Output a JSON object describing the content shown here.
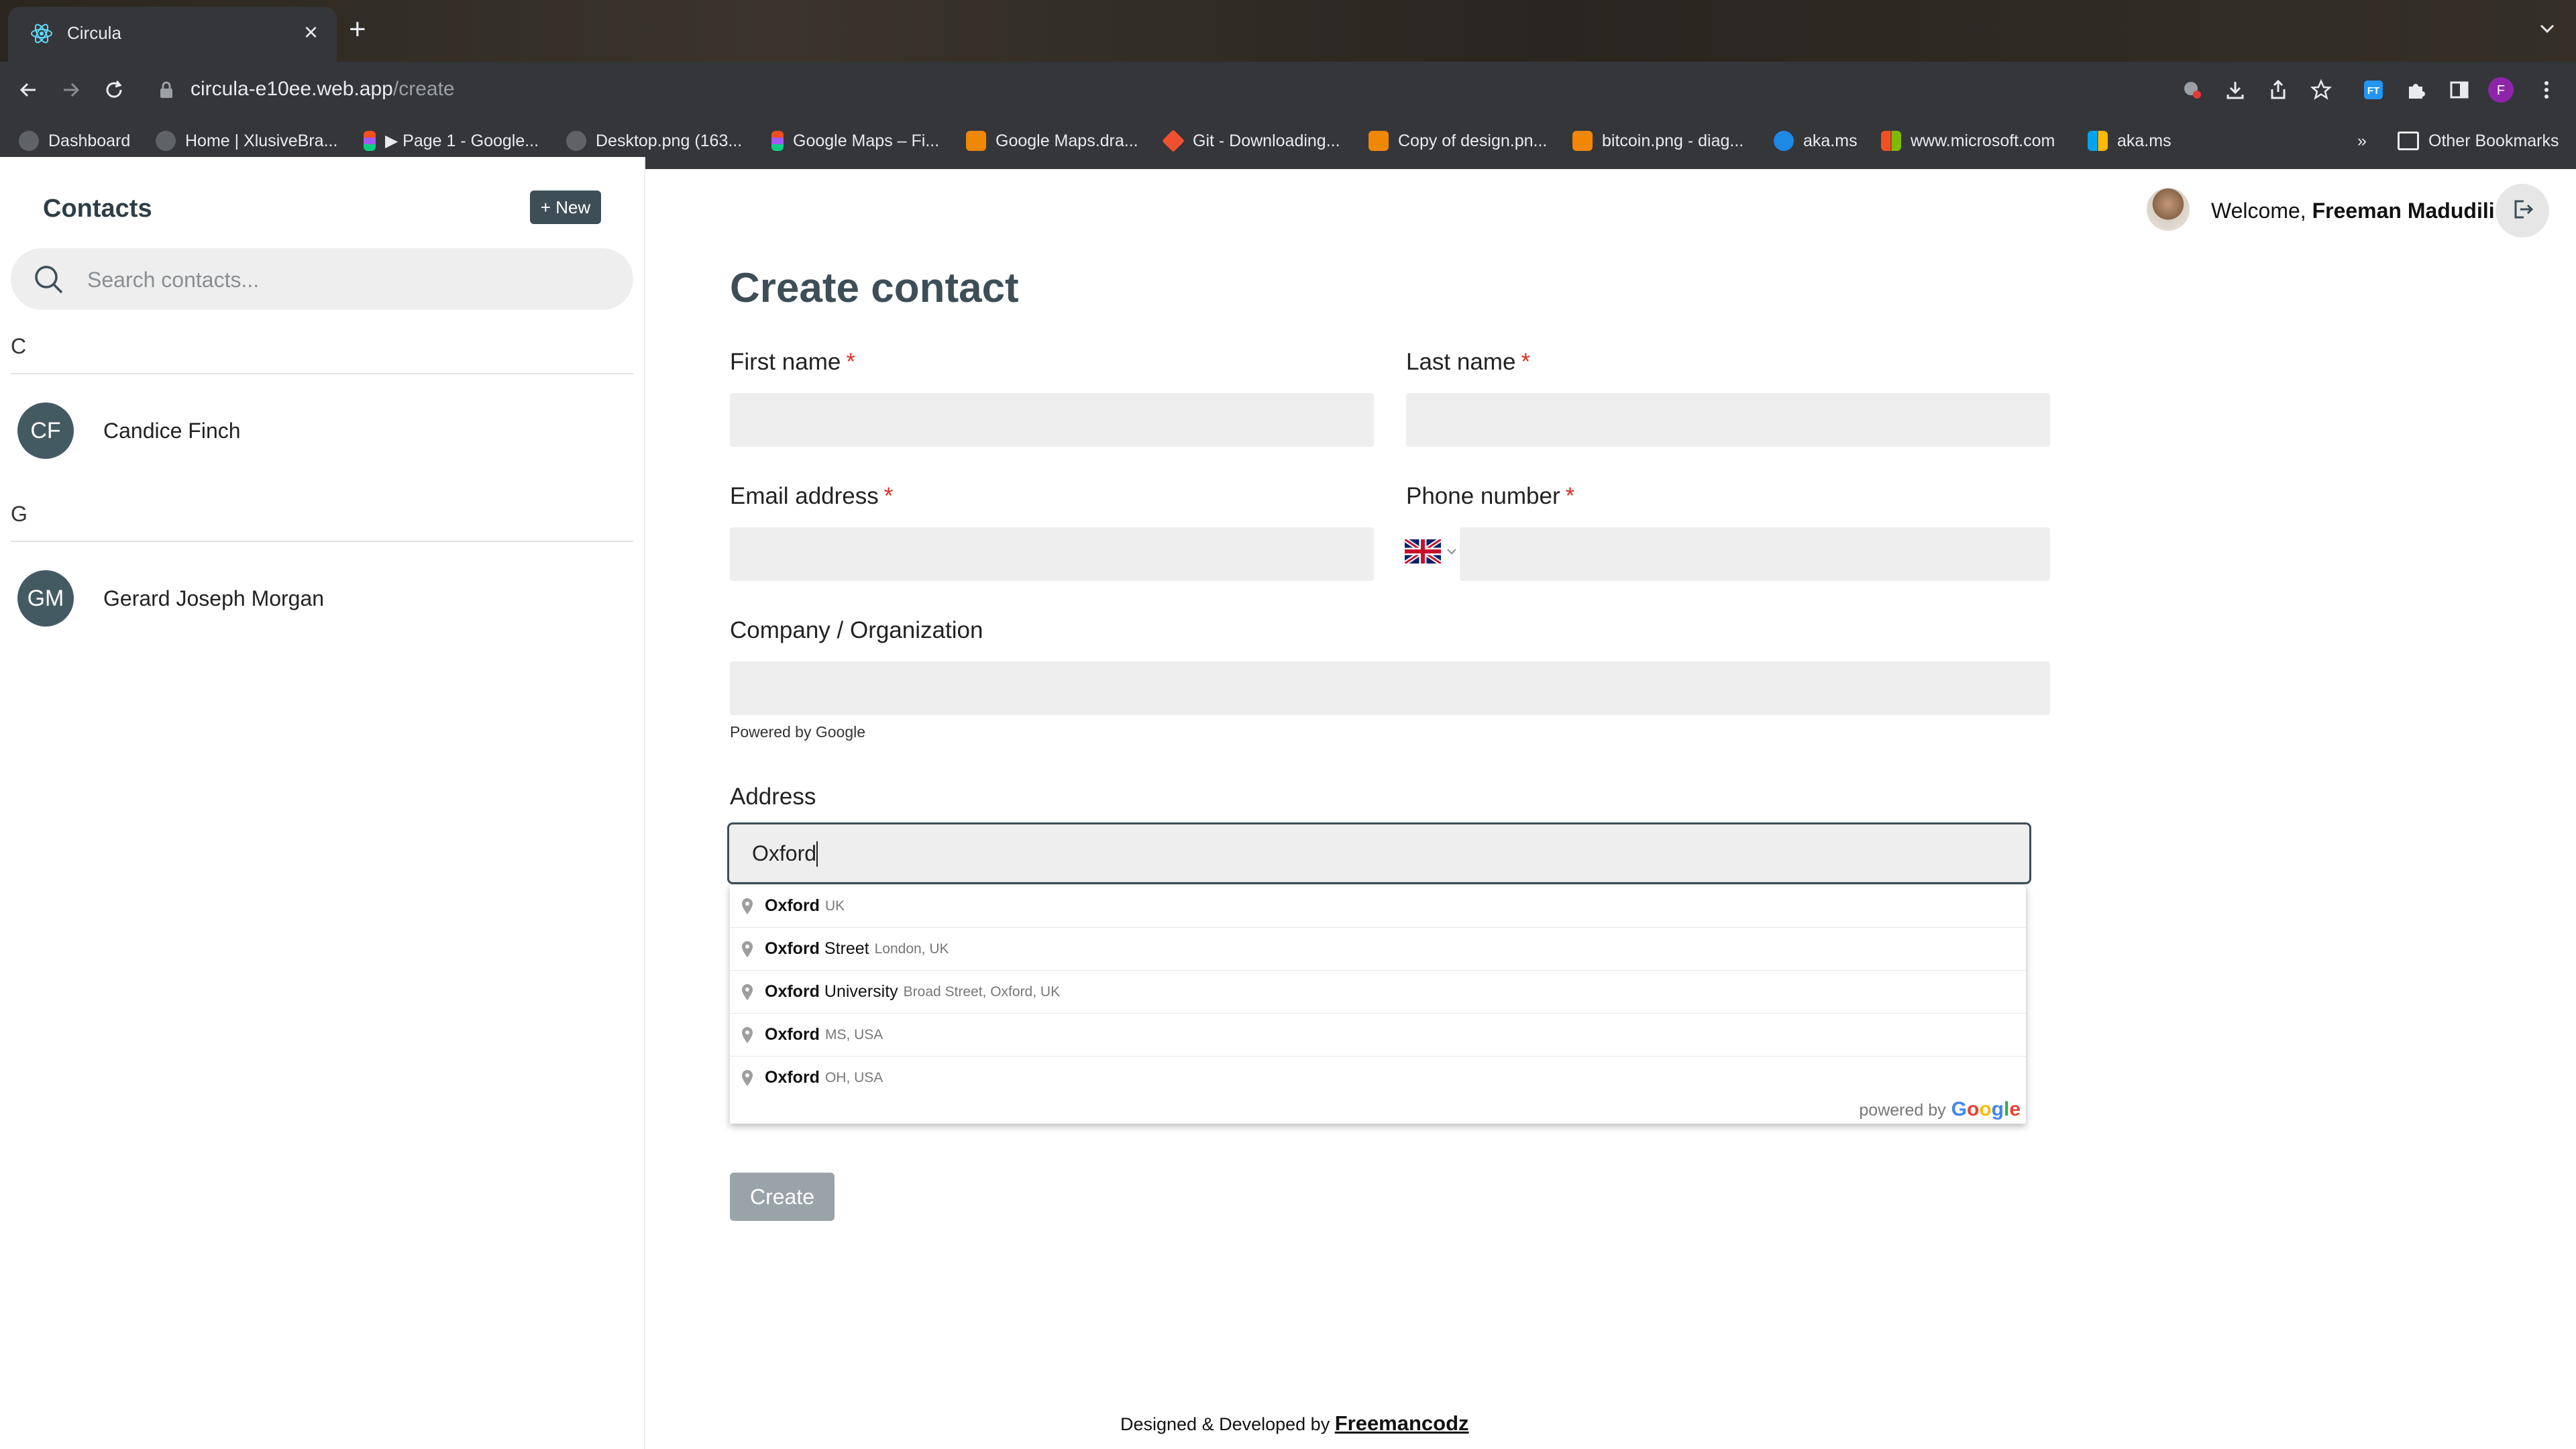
{
  "browser": {
    "tab_title": "Circula",
    "url_host": "circula-e10ee.web.app",
    "url_path": "/create",
    "profile_initial": "F",
    "bookmarks": [
      {
        "label": "Dashboard",
        "icon": "globe-icon"
      },
      {
        "label": "Home | XlusiveBra...",
        "icon": "globe-icon"
      },
      {
        "label": "▶ Page 1 - Google...",
        "icon": "figma-icon"
      },
      {
        "label": "Desktop.png (163...",
        "icon": "globe-icon"
      },
      {
        "label": "Google Maps – Fi...",
        "icon": "figma-icon"
      },
      {
        "label": "Google Maps.dra...",
        "icon": "drawio-icon"
      },
      {
        "label": "Git - Downloading...",
        "icon": "git-icon"
      },
      {
        "label": "Copy of design.pn...",
        "icon": "drawio-icon"
      },
      {
        "label": "bitcoin.png - diag...",
        "icon": "drawio-icon"
      },
      {
        "label": "aka.ms",
        "icon": "aka-icon"
      },
      {
        "label": "www.microsoft.com",
        "icon": "microsoft-icon"
      },
      {
        "label": "aka.ms",
        "icon": "microsoft-icon"
      }
    ],
    "bookmarks_overflow": "»",
    "other_bookmarks": "Other Bookmarks"
  },
  "sidebar": {
    "title": "Contacts",
    "new_button": "+ New",
    "search_placeholder": "Search contacts...",
    "groups": [
      {
        "letter": "C",
        "contacts": [
          {
            "initials": "CF",
            "name": "Candice Finch"
          }
        ]
      },
      {
        "letter": "G",
        "contacts": [
          {
            "initials": "GM",
            "name": "Gerard Joseph Morgan"
          }
        ]
      }
    ]
  },
  "header": {
    "welcome_prefix": "Welcome, ",
    "user_name": "Freeman Madudili"
  },
  "form": {
    "title": "Create contact",
    "first_name_label": "First name",
    "last_name_label": "Last name",
    "email_label": "Email address",
    "phone_label": "Phone number",
    "company_label": "Company / Organization",
    "powered_by": "Powered by Google",
    "address_label": "Address",
    "address_value": "Oxford",
    "required_mark": "*",
    "create_button": "Create"
  },
  "autocomplete": {
    "suggestions": [
      {
        "match": "Oxford",
        "rest": "",
        "secondary": "UK"
      },
      {
        "match": "Oxford",
        "rest": " Street",
        "secondary": "London, UK"
      },
      {
        "match": "Oxford",
        "rest": " University",
        "secondary": "Broad Street, Oxford, UK"
      },
      {
        "match": "Oxford",
        "rest": "",
        "secondary": "MS, USA"
      },
      {
        "match": "Oxford",
        "rest": "",
        "secondary": "OH, USA"
      }
    ],
    "powered_by": "powered by",
    "google": "Google"
  },
  "footer": {
    "text": "Designed & Developed by ",
    "link": "Freemancodz"
  },
  "colors": {
    "accent": "#3d4e57",
    "avatar_bg": "#445a63",
    "required": "#d93025",
    "field_bg": "#eeeeee",
    "button_disabled": "#9aa3a8"
  }
}
